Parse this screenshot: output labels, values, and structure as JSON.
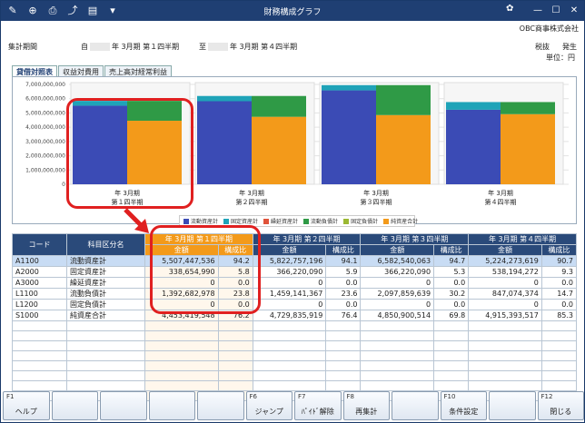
{
  "title": "財務構成グラフ",
  "company": "OBC商事株式会社",
  "header": {
    "period_label": "集計期間",
    "from_label": "自",
    "from_text": "年 3月期 第１四半期",
    "to_label": "至",
    "to_text": "年 3月期 第４四半期",
    "tax_label": "税抜",
    "basis_label": "発生",
    "unit_label": "単位：円"
  },
  "tabs": [
    "貸借対照表",
    "収益対費用",
    "売上高対経常利益"
  ],
  "legend": [
    {
      "label": "流動資産計",
      "color": "#3b4bb5"
    },
    {
      "label": "固定資産計",
      "color": "#1fa3b8"
    },
    {
      "label": "繰延資産計",
      "color": "#e0533a"
    },
    {
      "label": "流動負債計",
      "color": "#2f9a46"
    },
    {
      "label": "固定負債計",
      "color": "#9bb832"
    },
    {
      "label": "純資産合計",
      "color": "#f39a1a"
    }
  ],
  "chart_data": {
    "type": "bar",
    "categories": [
      "年 3月期 第１四半期",
      "年 3月期 第２四半期",
      "年 3月期 第３四半期",
      "年 3月期 第４四半期"
    ],
    "y_ticks": [
      "7,000,000,000",
      "6,000,000,000",
      "5,000,000,000",
      "4,000,000,000",
      "3,000,000,000",
      "2,000,000,000",
      "1,000,000,000",
      "0"
    ],
    "ylim": [
      0,
      7000000000
    ],
    "assets": [
      {
        "name": "流動資産計",
        "values": [
          5507447536,
          5822757196,
          6582540063,
          5224273619
        ]
      },
      {
        "name": "固定資産計",
        "values": [
          338654990,
          366220090,
          366220090,
          538194272
        ]
      }
    ],
    "liabilities": [
      {
        "name": "流動負債計",
        "values": [
          1392682978,
          1459141367,
          2097859639,
          847074374
        ]
      },
      {
        "name": "純資産合計",
        "values": [
          4453419548,
          4729835919,
          4850900514,
          4915393517
        ]
      }
    ]
  },
  "table": {
    "col_code": "コード",
    "col_name": "科目区分名",
    "col_amount": "金額",
    "col_ratio": "構成比",
    "periods": [
      "年 3月期 第１四半期",
      "年 3月期 第２四半期",
      "年 3月期 第３四半期",
      "年 3月期 第４四半期"
    ],
    "rows": [
      {
        "code": "A1100",
        "name": "流動資産計",
        "v": [
          "5,507,447,536",
          "94.2",
          "5,822,757,196",
          "94.1",
          "6,582,540,063",
          "94.7",
          "5,224,273,619",
          "90.7"
        ]
      },
      {
        "code": "A2000",
        "name": "固定資産計",
        "v": [
          "338,654,990",
          "5.8",
          "366,220,090",
          "5.9",
          "366,220,090",
          "5.3",
          "538,194,272",
          "9.3"
        ]
      },
      {
        "code": "A3000",
        "name": "繰延資産計",
        "v": [
          "0",
          "0.0",
          "0",
          "0.0",
          "0",
          "0.0",
          "0",
          "0.0"
        ]
      },
      {
        "code": "L1100",
        "name": "流動負債計",
        "v": [
          "1,392,682,978",
          "23.8",
          "1,459,141,367",
          "23.6",
          "2,097,859,639",
          "30.2",
          "847,074,374",
          "14.7"
        ]
      },
      {
        "code": "L1200",
        "name": "固定負債計",
        "v": [
          "0",
          "0.0",
          "0",
          "0.0",
          "0",
          "0.0",
          "0",
          "0.0"
        ]
      },
      {
        "code": "S1000",
        "name": "純資産合計",
        "v": [
          "4,453,419,548",
          "76.2",
          "4,729,835,919",
          "76.4",
          "4,850,900,514",
          "69.8",
          "4,915,393,517",
          "85.3"
        ]
      }
    ]
  },
  "fkeys": [
    {
      "n": "F1",
      "l": "ヘルプ"
    },
    {
      "n": "",
      "l": ""
    },
    {
      "n": "",
      "l": ""
    },
    {
      "n": "",
      "l": ""
    },
    {
      "n": "",
      "l": ""
    },
    {
      "n": "F6",
      "l": "ジャンプ"
    },
    {
      "n": "F7",
      "l": "ﾊﾟｲﾄﾞ解除"
    },
    {
      "n": "F8",
      "l": "再集計"
    },
    {
      "n": "",
      "l": ""
    },
    {
      "n": "F10",
      "l": "条件設定"
    },
    {
      "n": "",
      "l": ""
    },
    {
      "n": "F12",
      "l": "閉じる"
    }
  ]
}
